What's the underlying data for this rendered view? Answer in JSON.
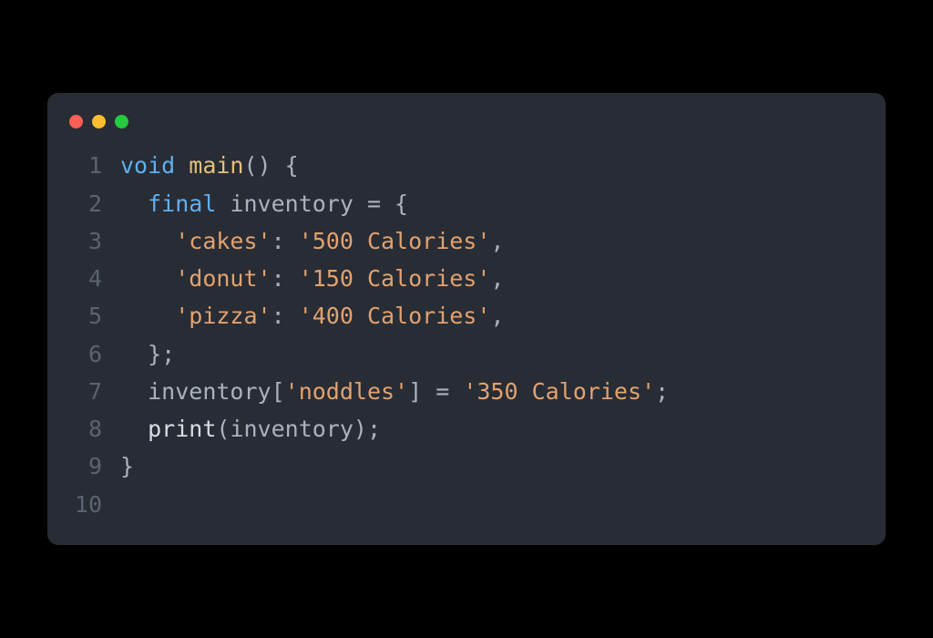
{
  "window": {
    "controls": {
      "close": "close",
      "minimize": "minimize",
      "maximize": "maximize"
    }
  },
  "code": {
    "language": "dart",
    "lines": [
      {
        "num": "1",
        "tokens": [
          {
            "t": "void",
            "c": "tok-keyword"
          },
          {
            "t": " ",
            "c": "tok-default"
          },
          {
            "t": "main",
            "c": "tok-funcname"
          },
          {
            "t": "() {",
            "c": "tok-punct"
          }
        ]
      },
      {
        "num": "2",
        "tokens": [
          {
            "t": "  ",
            "c": "tok-default"
          },
          {
            "t": "final",
            "c": "tok-keyword"
          },
          {
            "t": " ",
            "c": "tok-default"
          },
          {
            "t": "inventory",
            "c": "tok-ident"
          },
          {
            "t": " = {",
            "c": "tok-punct"
          }
        ]
      },
      {
        "num": "3",
        "tokens": [
          {
            "t": "    ",
            "c": "tok-default"
          },
          {
            "t": "'cakes'",
            "c": "tok-string"
          },
          {
            "t": ": ",
            "c": "tok-punct"
          },
          {
            "t": "'500 Calories'",
            "c": "tok-string"
          },
          {
            "t": ",",
            "c": "tok-punct"
          }
        ]
      },
      {
        "num": "4",
        "tokens": [
          {
            "t": "    ",
            "c": "tok-default"
          },
          {
            "t": "'donut'",
            "c": "tok-string"
          },
          {
            "t": ": ",
            "c": "tok-punct"
          },
          {
            "t": "'150 Calories'",
            "c": "tok-string"
          },
          {
            "t": ",",
            "c": "tok-punct"
          }
        ]
      },
      {
        "num": "5",
        "tokens": [
          {
            "t": "    ",
            "c": "tok-default"
          },
          {
            "t": "'pizza'",
            "c": "tok-string"
          },
          {
            "t": ": ",
            "c": "tok-punct"
          },
          {
            "t": "'400 Calories'",
            "c": "tok-string"
          },
          {
            "t": ",",
            "c": "tok-punct"
          }
        ]
      },
      {
        "num": "6",
        "tokens": [
          {
            "t": "  };",
            "c": "tok-punct"
          }
        ]
      },
      {
        "num": "7",
        "tokens": [
          {
            "t": "  ",
            "c": "tok-default"
          },
          {
            "t": "inventory",
            "c": "tok-ident"
          },
          {
            "t": "[",
            "c": "tok-punct"
          },
          {
            "t": "'noddles'",
            "c": "tok-string"
          },
          {
            "t": "] = ",
            "c": "tok-punct"
          },
          {
            "t": "'350 Calories'",
            "c": "tok-string"
          },
          {
            "t": ";",
            "c": "tok-punct"
          }
        ]
      },
      {
        "num": "8",
        "tokens": [
          {
            "t": "  ",
            "c": "tok-default"
          },
          {
            "t": "print",
            "c": "tok-call"
          },
          {
            "t": "(",
            "c": "tok-punct"
          },
          {
            "t": "inventory",
            "c": "tok-ident"
          },
          {
            "t": ");",
            "c": "tok-punct"
          }
        ]
      },
      {
        "num": "9",
        "tokens": [
          {
            "t": "}",
            "c": "tok-punct"
          }
        ]
      },
      {
        "num": "10",
        "tokens": []
      }
    ]
  }
}
